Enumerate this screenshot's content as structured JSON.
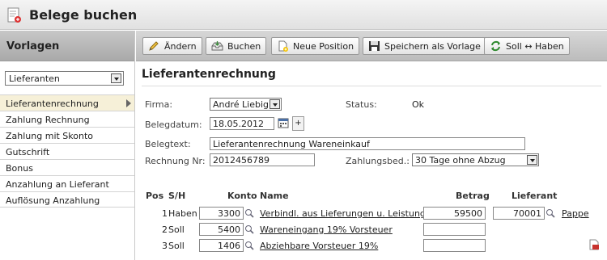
{
  "app": {
    "title": "Belege buchen",
    "icon": "document-pen-icon"
  },
  "sidebar": {
    "header": "Vorlagen",
    "select_value": "Lieferanten",
    "items": [
      {
        "label": "Lieferantenrechnung",
        "active": true
      },
      {
        "label": "Zahlung Rechnung"
      },
      {
        "label": "Zahlung mit Skonto"
      },
      {
        "label": "Gutschrift"
      },
      {
        "label": "Bonus"
      },
      {
        "label": "Anzahlung an Lieferant"
      },
      {
        "label": "Auflösung Anzahlung"
      }
    ]
  },
  "toolbar": {
    "edit_label": "Ändern",
    "book_label": "Buchen",
    "new_position_label": "Neue Position",
    "save_template_label": "Speichern als Vorlage",
    "swap_label": "Soll ↔ Haben"
  },
  "form": {
    "title": "Lieferantenrechnung",
    "firma_label": "Firma:",
    "firma_value": "André Liebig",
    "status_label": "Status:",
    "status_value": "Ok",
    "belegdatum_label": "Belegdatum:",
    "belegdatum_value": "18.05.2012",
    "plus_label": "+",
    "belegtext_label": "Belegtext:",
    "belegtext_value": "Lieferantenrechnung Wareneinkauf",
    "rechnung_label": "Rechnung Nr:",
    "rechnung_value": "2012456789",
    "zahlungsbed_label": "Zahlungsbed.:",
    "zahlungsbed_value": "30 Tage ohne Abzug"
  },
  "table": {
    "headers": {
      "pos": "Pos",
      "sh": "S/H",
      "konto": "Konto",
      "name": "Name",
      "betrag": "Betrag",
      "lieferant": "Lieferant"
    },
    "rows": [
      {
        "pos": "1",
        "sh": "Haben",
        "konto": "3300",
        "name": "Verbindl. aus Lieferungen u. Leistungen",
        "betrag": "59500",
        "lieferant": "70001",
        "lieferant_name": "Pappe"
      },
      {
        "pos": "2",
        "sh": "Soll",
        "konto": "5400",
        "name": "Wareneingang 19% Vorsteuer",
        "betrag": ""
      },
      {
        "pos": "3",
        "sh": "Soll",
        "konto": "1406",
        "name": "Abziehbare Vorsteuer 19%",
        "betrag": ""
      }
    ]
  }
}
